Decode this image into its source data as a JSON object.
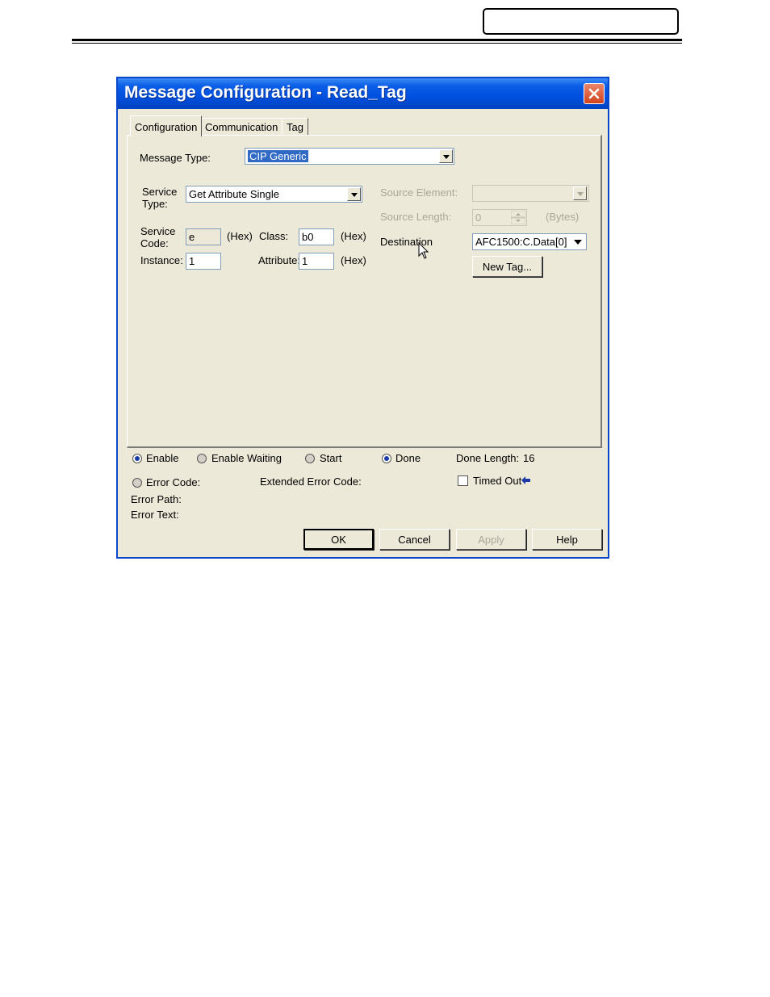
{
  "window": {
    "title": "Message Configuration - Read_Tag"
  },
  "tabs": [
    {
      "label": "Configuration"
    },
    {
      "label": "Communication"
    },
    {
      "label": "Tag"
    }
  ],
  "config": {
    "message_type_label": "Message Type:",
    "message_type_value": "CIP Generic",
    "service_type_label_1": "Service",
    "service_type_label_2": "Type:",
    "service_type_value": "Get Attribute Single",
    "service_code_label_1": "Service",
    "service_code_label_2": "Code:",
    "service_code_value": "e",
    "hex_label": "(Hex)",
    "class_label": "Class:",
    "class_value": "b0",
    "instance_label": "Instance:",
    "instance_value": "1",
    "attribute_label": "Attribute:",
    "attribute_value": "1",
    "source_element_label": "Source Element:",
    "source_element_value": "",
    "source_length_label": "Source Length:",
    "source_length_value": "0",
    "bytes_label": "(Bytes)",
    "destination_label": "Destination",
    "destination_value": "AFC1500:C.Data[0]",
    "new_tag_button": "New Tag..."
  },
  "status": {
    "enable": "Enable",
    "enable_waiting": "Enable Waiting",
    "start": "Start",
    "done": "Done",
    "done_length_label": "Done Length:",
    "done_length_value": "16",
    "error_code_label": "Error Code:",
    "extended_error_code_label": "Extended Error Code:",
    "timed_out_label": "Timed Out",
    "error_path_label": "Error Path:",
    "error_text_label": "Error Text:"
  },
  "buttons": {
    "ok": "OK",
    "cancel": "Cancel",
    "apply": "Apply",
    "help": "Help"
  },
  "colors": {
    "titlebar": "#0051df",
    "dialog_bg": "#ece9d8",
    "selection": "#316ac5",
    "radio_selected": "#1b3aa8"
  }
}
